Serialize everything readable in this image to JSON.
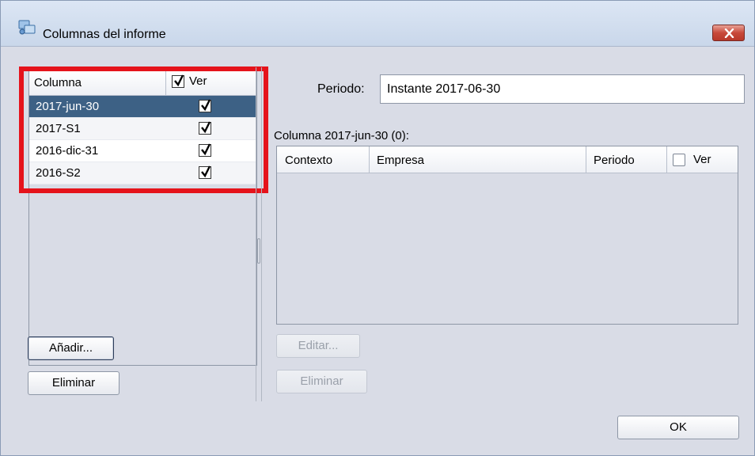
{
  "window": {
    "title": "Columnas del informe",
    "app_icon": "app-icon",
    "close_icon": "close-icon"
  },
  "columns_table": {
    "header_column": "Columna",
    "header_ver": "Ver",
    "header_ver_checked": true,
    "rows": [
      {
        "label": "2017-jun-30",
        "checked": true,
        "selected": true
      },
      {
        "label": "2017-S1",
        "checked": true,
        "selected": false
      },
      {
        "label": "2016-dic-31",
        "checked": true,
        "selected": false
      },
      {
        "label": "2016-S2",
        "checked": true,
        "selected": false
      }
    ]
  },
  "left_buttons": {
    "add": "Añadir...",
    "remove": "Eliminar"
  },
  "periodo": {
    "label": "Periodo:",
    "value": "Instante 2017-06-30"
  },
  "column_detail": {
    "caption": "Columna 2017-jun-30 (0):",
    "headers": {
      "context": "Contexto",
      "company": "Empresa",
      "period": "Periodo",
      "ver": "Ver"
    },
    "ver_checked": false
  },
  "right_buttons": {
    "edit": "Editar...",
    "remove": "Eliminar"
  },
  "ok_button": "OK",
  "highlight_color": "#e5131b",
  "selection_color": "#3d6185"
}
